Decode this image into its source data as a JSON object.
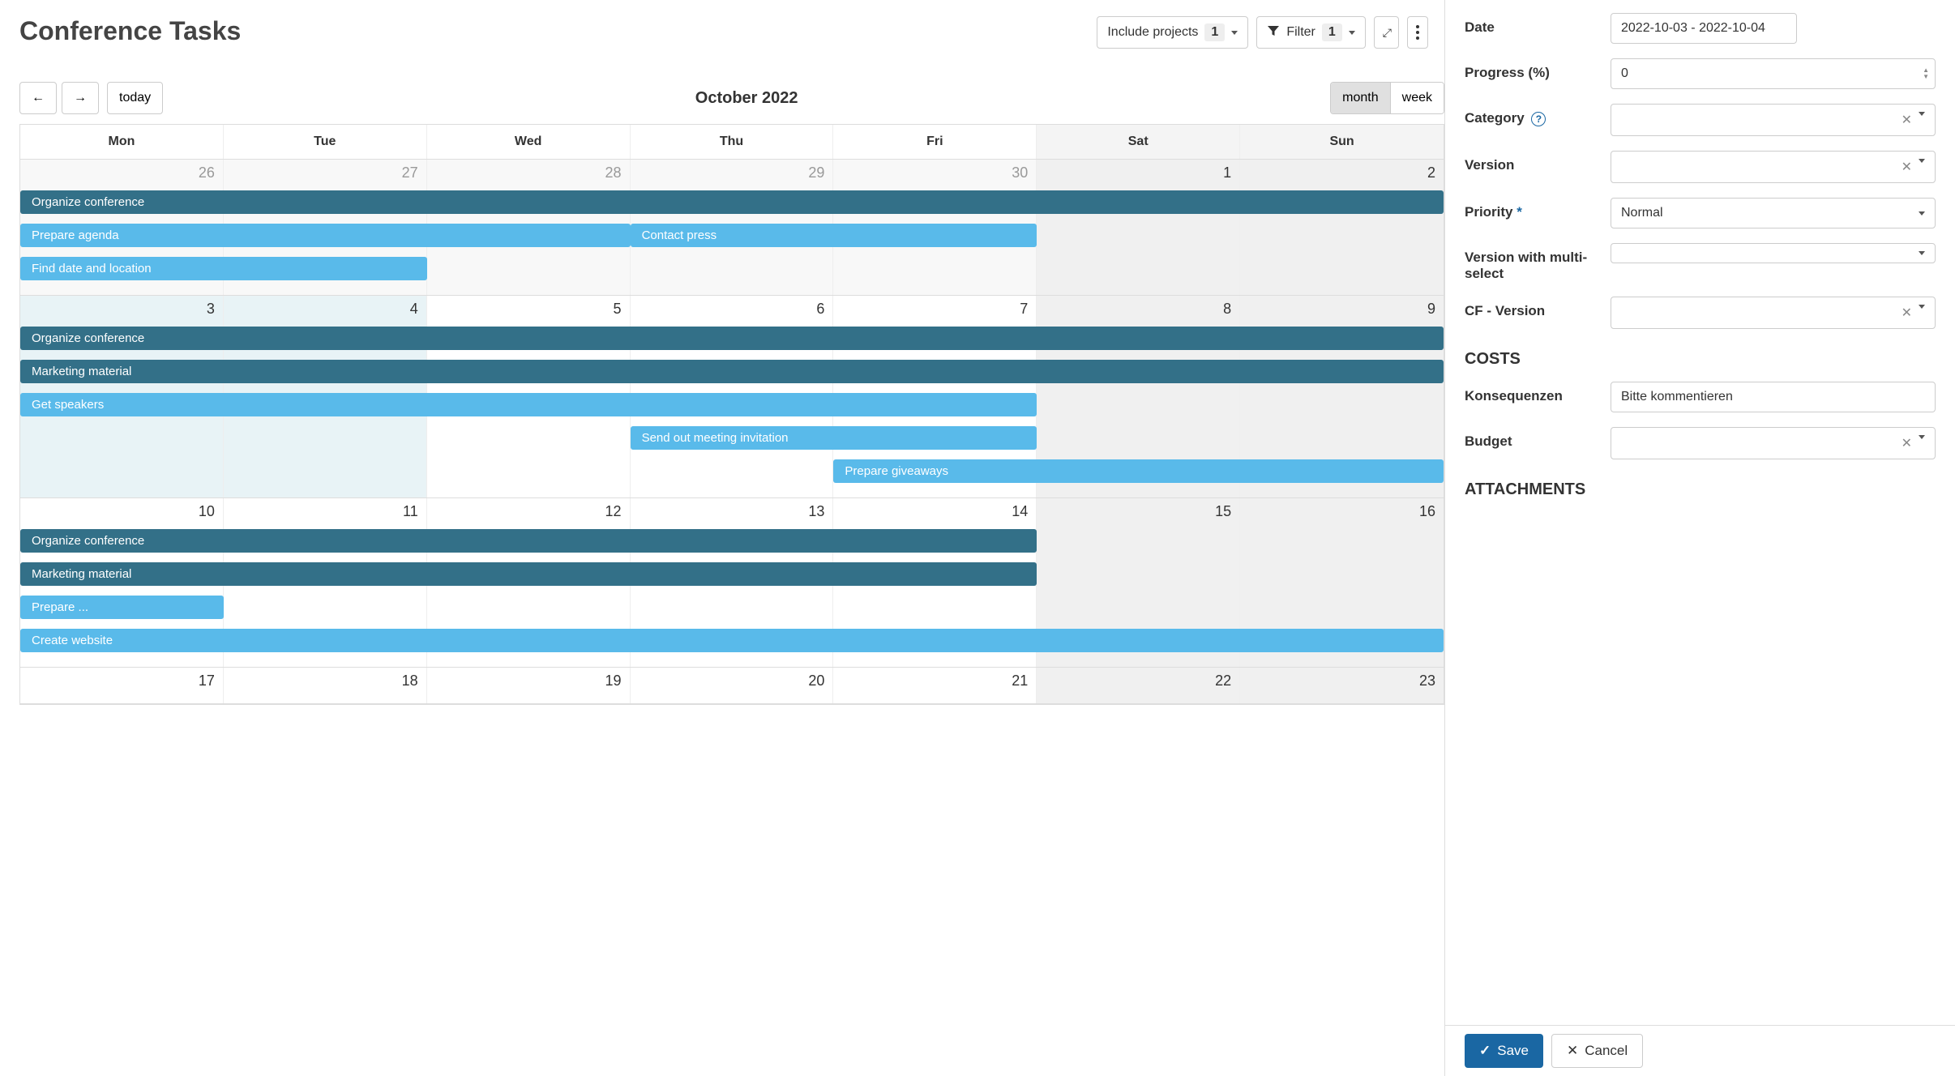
{
  "page_title": "Conference Tasks",
  "toolbar": {
    "include_projects_label": "Include projects",
    "include_projects_count": "1",
    "filter_label": "Filter",
    "filter_count": "1"
  },
  "calendar": {
    "today_label": "today",
    "title": "October 2022",
    "view_month": "month",
    "view_week": "week",
    "days": [
      "Mon",
      "Tue",
      "Wed",
      "Thu",
      "Fri",
      "Sat",
      "Sun"
    ],
    "rows": [
      {
        "dates": [
          {
            "n": "26",
            "muted": true
          },
          {
            "n": "27",
            "muted": true
          },
          {
            "n": "28",
            "muted": true
          },
          {
            "n": "29",
            "muted": true
          },
          {
            "n": "30",
            "muted": true
          },
          {
            "n": "1",
            "weekend": true
          },
          {
            "n": "2",
            "weekend": true
          }
        ],
        "events": [
          {
            "label": "Organize conference",
            "start": 0,
            "span": 7,
            "tone": "dark"
          },
          {
            "label": "Prepare agenda",
            "start": 0,
            "span": 3,
            "tone": "light"
          },
          {
            "label": "Contact press",
            "start": 3,
            "span": 2,
            "tone": "light",
            "same_row_after": true
          },
          {
            "label": "Find date and location",
            "start": 0,
            "span": 2,
            "tone": "light"
          }
        ]
      },
      {
        "dates": [
          {
            "n": "3",
            "highlight": true
          },
          {
            "n": "4",
            "highlight": true
          },
          {
            "n": "5"
          },
          {
            "n": "6"
          },
          {
            "n": "7"
          },
          {
            "n": "8",
            "weekend": true
          },
          {
            "n": "9",
            "weekend": true
          }
        ],
        "events": [
          {
            "label": "Organize conference",
            "start": 0,
            "span": 7,
            "tone": "dark"
          },
          {
            "label": "Marketing material",
            "start": 0,
            "span": 7,
            "tone": "dark"
          },
          {
            "label": "Get speakers",
            "start": 0,
            "span": 5,
            "tone": "light"
          },
          {
            "label": "Send out meeting invitation",
            "start": 3,
            "span": 2,
            "tone": "light"
          },
          {
            "label": "Prepare giveaways",
            "start": 4,
            "span": 3,
            "tone": "light"
          }
        ]
      },
      {
        "dates": [
          {
            "n": "10"
          },
          {
            "n": "11"
          },
          {
            "n": "12"
          },
          {
            "n": "13"
          },
          {
            "n": "14"
          },
          {
            "n": "15",
            "weekend": true
          },
          {
            "n": "16",
            "weekend": true
          }
        ],
        "events": [
          {
            "label": "Organize conference",
            "start": 0,
            "span": 5,
            "tone": "dark"
          },
          {
            "label": "Marketing material",
            "start": 0,
            "span": 5,
            "tone": "dark"
          },
          {
            "label": "Prepare ...",
            "start": 0,
            "span": 1,
            "tone": "light"
          },
          {
            "label": "Create website",
            "start": 0,
            "span": 7,
            "tone": "light"
          }
        ]
      },
      {
        "dates": [
          {
            "n": "17"
          },
          {
            "n": "18"
          },
          {
            "n": "19"
          },
          {
            "n": "20"
          },
          {
            "n": "21"
          },
          {
            "n": "22",
            "weekend": true
          },
          {
            "n": "23",
            "weekend": true
          }
        ],
        "events": []
      }
    ]
  },
  "form": {
    "date_label": "Date",
    "date_value": "2022-10-03 - 2022-10-04",
    "progress_label": "Progress (%)",
    "progress_value": "0",
    "category_label": "Category",
    "version_label": "Version",
    "priority_label": "Priority",
    "priority_value": "Normal",
    "version_multi_label": "Version with multi-select",
    "cf_version_label": "CF - Version",
    "section_costs": "COSTS",
    "konsequenzen_label": "Konsequenzen",
    "konsequenzen_value": "Bitte kommentieren",
    "budget_label": "Budget",
    "section_attachments": "ATTACHMENTS",
    "save_label": "Save",
    "cancel_label": "Cancel"
  }
}
